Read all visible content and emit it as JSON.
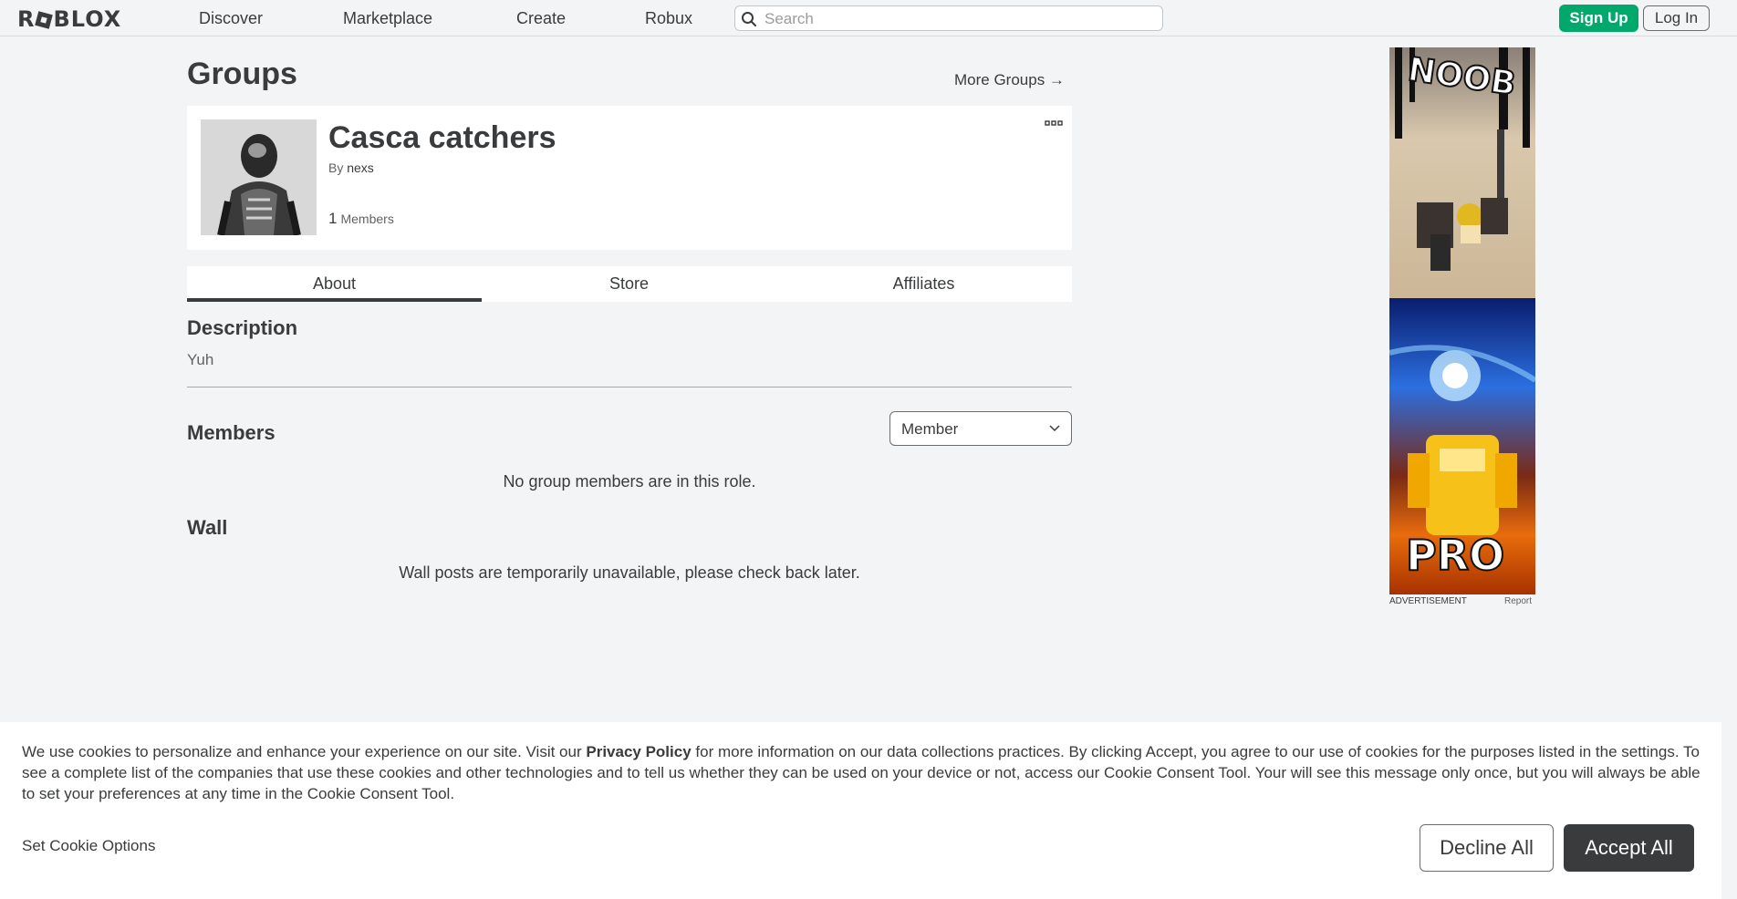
{
  "nav": {
    "logo": "ROBLOX",
    "links": [
      "Discover",
      "Marketplace",
      "Create",
      "Robux"
    ],
    "search_placeholder": "Search",
    "signup_label": "Sign Up",
    "login_label": "Log In"
  },
  "page": {
    "title": "Groups",
    "more_groups": "More Groups →"
  },
  "group": {
    "name": "Casca catchers",
    "owner_prefix": "By",
    "owner": "nexs",
    "member_count": "1",
    "member_label": "Members"
  },
  "tabs": [
    "About",
    "Store",
    "Affiliates"
  ],
  "description": {
    "title": "Description",
    "text": "Yuh"
  },
  "members": {
    "title": "Members",
    "role_selected": "Member",
    "empty_message": "No group members are in this role."
  },
  "wall": {
    "title": "Wall",
    "message": "Wall posts are temporarily unavailable, please check back later."
  },
  "ad": {
    "label": "ADVERTISEMENT",
    "report": "Report",
    "top_text": "NOOB",
    "bottom_text": "PRO"
  },
  "cookie": {
    "text_before": "We use cookies to personalize and enhance your experience on our site. Visit our ",
    "privacy_link": "Privacy Policy",
    "text_after": " for more information on our data collections practices. By clicking Accept, you agree to our use of cookies for the purposes listed in the settings. To see a complete list of the companies that use these cookies and other technologies and to tell us whether they can be used on your device or not, access our Cookie Consent Tool. Your will see this message only once, but you will always be able to set your preferences at any time in the Cookie Consent Tool.",
    "options_label": "Set Cookie Options",
    "decline_label": "Decline All",
    "accept_label": "Accept All"
  },
  "colors": {
    "background": "#f2f4f5",
    "text": "#393b3d",
    "signup_green": "#00a86b",
    "accept_dark": "#393b3d"
  },
  "icons": [
    "search-icon",
    "more-options-icon",
    "chevron-down-icon",
    "arrow-right-icon"
  ]
}
